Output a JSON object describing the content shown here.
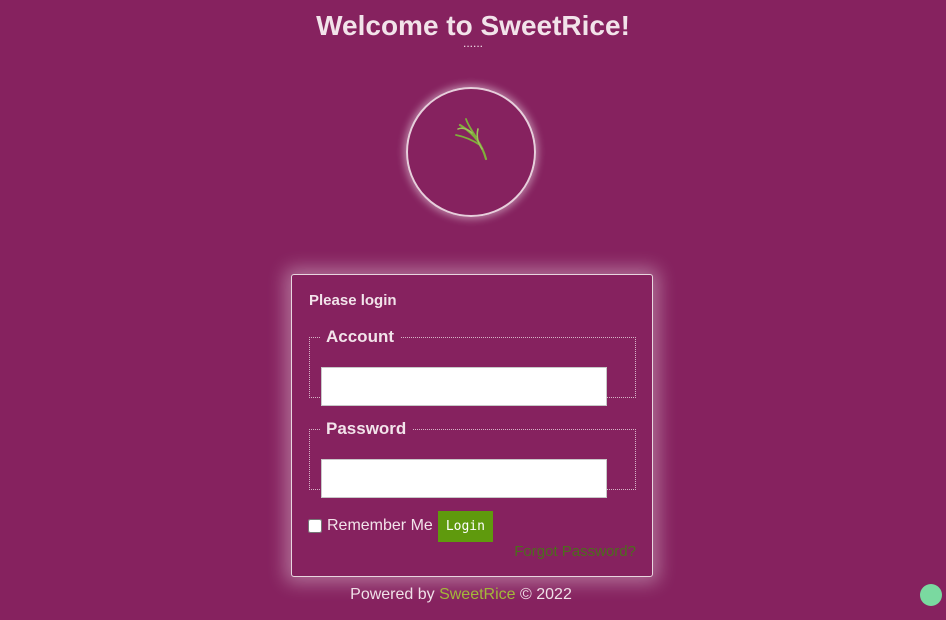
{
  "header": {
    "title": "Welcome to SweetRice!",
    "subtitle": "......"
  },
  "logo": {
    "icon": "rice-stalk-icon",
    "color": "#7fae3a"
  },
  "login": {
    "heading": "Please login",
    "account_legend": "Account",
    "account_value": "",
    "password_legend": "Password",
    "password_value": "",
    "remember_label": "Remember Me",
    "remember_checked": false,
    "login_button": "Login",
    "forgot_link": "Forgot Password?"
  },
  "footer": {
    "prefix": "Powered by ",
    "link": "SweetRice",
    "suffix": " © 2022"
  },
  "colors": {
    "background": "#86225f",
    "button": "#5f9a0d",
    "link": "#a3b73a",
    "status_dot": "#7ad9a0"
  }
}
